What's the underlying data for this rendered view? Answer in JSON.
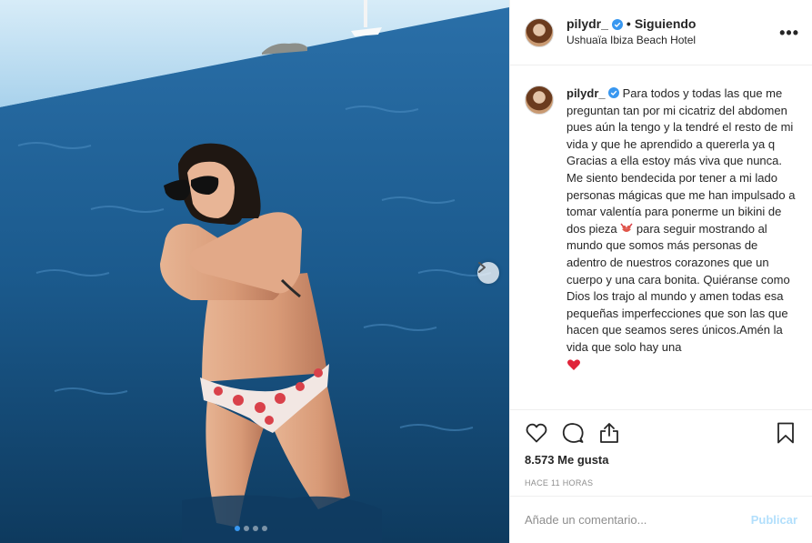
{
  "post": {
    "image_alt": "Woman standing in the sea wearing a floral bikini and sunglasses",
    "carousel": {
      "total_dots": 4,
      "active_index": 0
    }
  },
  "header": {
    "username": "pilydr_",
    "separator": "•",
    "following_label": "Siguiendo",
    "location": "Ushuaïa Ibiza Beach Hotel",
    "more_label": "•••"
  },
  "caption": {
    "username": "pilydr_",
    "text": "Para todos y todas las que me preguntan tan por mi cicatriz del abdomen pues aún la tengo y la tendré el resto de mi vida y que he aprendido a quererla ya q Gracias a ella estoy más viva que nunca. Me siento bendecida por tener a mi lado personas mágicas que me han impulsado a tomar valentía para ponerme un bikini de dos pieza",
    "text_after_emoji": " para seguir mostrando al mundo que somos más personas de adentro de nuestros corazones que un cuerpo y una cara bonita. Quiéranse como Dios los trajo al mundo y amen todas esa pequeñas imperfecciones que son las que hacen que seamos seres únicos.Amén la vida que solo hay una"
  },
  "stats": {
    "likes": "8.573 Me gusta",
    "time": "Hace 11 horas"
  },
  "comment_box": {
    "placeholder": "Añade un comentario...",
    "publish_label": "Publicar"
  },
  "colors": {
    "verified": "#3897f0",
    "publish_disabled": "#b2dffc",
    "heart": "#ed4956"
  }
}
